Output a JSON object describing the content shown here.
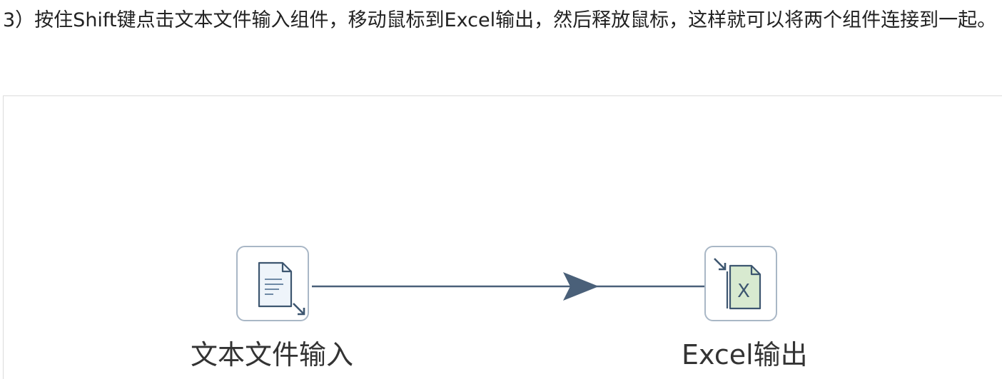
{
  "instruction": {
    "text": "3）按住Shift键点击文本文件输入组件，移动鼠标到Excel输出，然后释放鼠标，这样就可以将两个组件连接到一起。"
  },
  "flow": {
    "source": {
      "label": "文本文件输入",
      "icon": "text-file-input-icon"
    },
    "target": {
      "label": "Excel输出",
      "icon": "excel-output-icon",
      "glyph": "X"
    },
    "connector": {
      "type": "arrow",
      "color": "#4a6079"
    },
    "colors": {
      "node_border": "#a9b7c6",
      "icon_stroke": "#3d5670",
      "excel_fill": "#d8ead0"
    }
  }
}
